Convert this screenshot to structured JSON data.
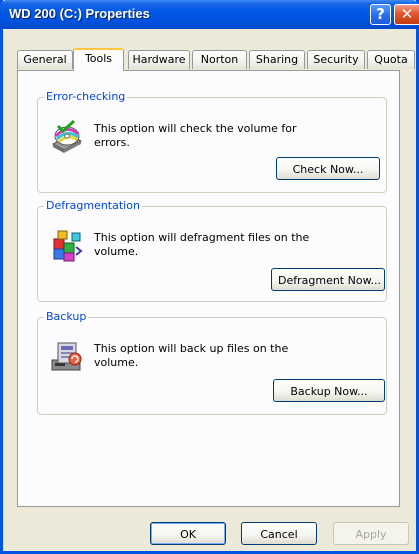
{
  "window": {
    "title": "WD 200 (C:) Properties"
  },
  "titlebar": {
    "help_glyph": "?",
    "close_glyph": "✕"
  },
  "tabs": [
    {
      "label": "General",
      "active": false
    },
    {
      "label": "Tools",
      "active": true
    },
    {
      "label": "Hardware",
      "active": false
    },
    {
      "label": "Norton",
      "active": false
    },
    {
      "label": "Sharing",
      "active": false
    },
    {
      "label": "Security",
      "active": false
    },
    {
      "label": "Quota",
      "active": false
    }
  ],
  "groups": {
    "error_checking": {
      "title": "Error-checking",
      "text": "This option will check the volume for errors.",
      "button": "Check Now...",
      "icon": "disk-check-icon"
    },
    "defragmentation": {
      "title": "Defragmentation",
      "text": "This option will defragment files on the volume.",
      "button": "Defragment Now...",
      "icon": "defragment-icon"
    },
    "backup": {
      "title": "Backup",
      "text": "This option will back up files on the volume.",
      "button": "Backup Now...",
      "icon": "backup-icon"
    }
  },
  "footer": {
    "ok": "OK",
    "cancel": "Cancel",
    "apply": "Apply"
  },
  "colors": {
    "titlebar": "#0058e6",
    "group_label": "#0046d5",
    "active_tab_highlight": "#ffc83c",
    "window_face": "#ece9d8"
  }
}
